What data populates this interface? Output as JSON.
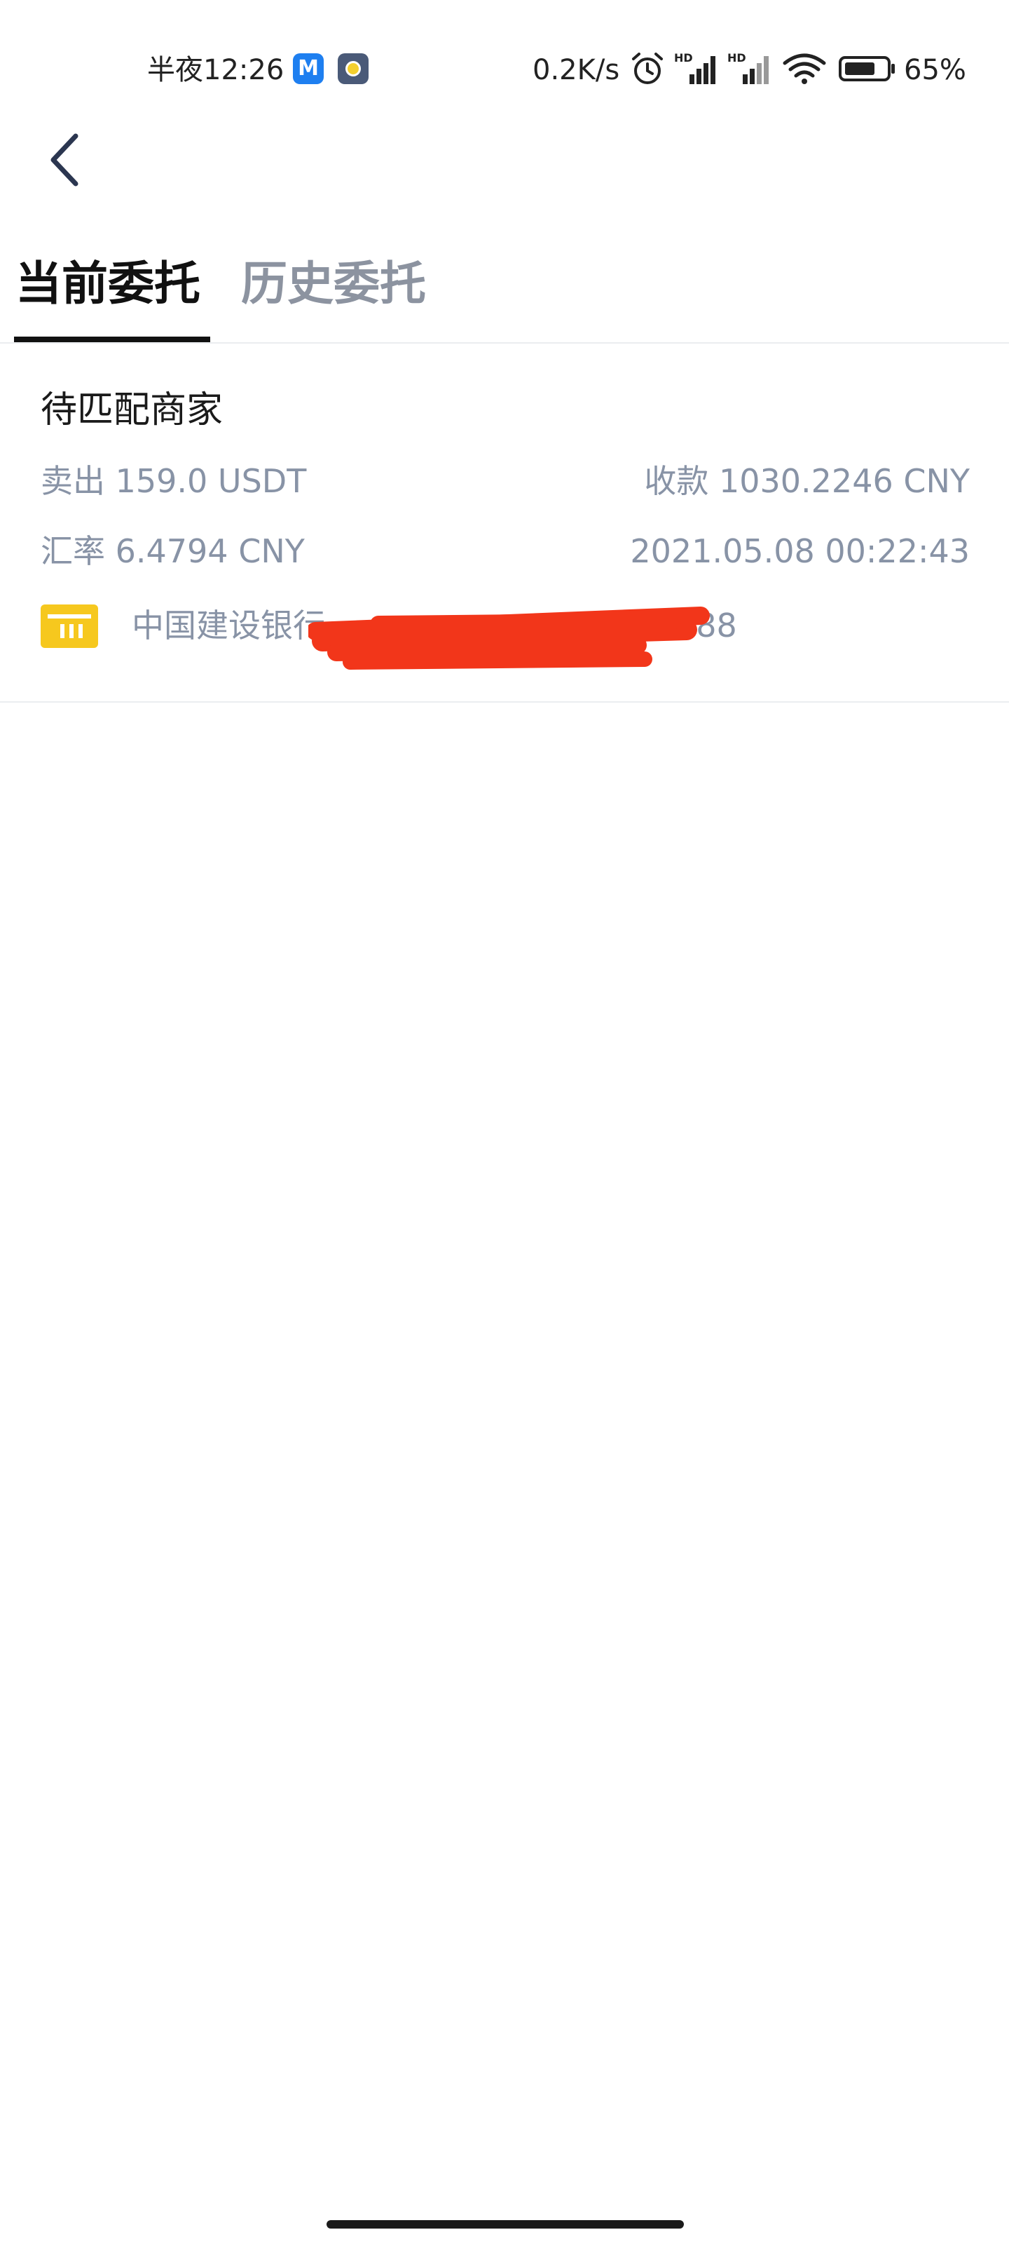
{
  "status_bar": {
    "time": "半夜12:26",
    "net_speed": "0.2K/s",
    "battery": "65%",
    "app_icons": [
      "m-app-icon",
      "eye-app-icon"
    ],
    "icons": [
      "alarm-icon",
      "hd-signal-icon",
      "hd-signal-icon",
      "wifi-icon",
      "battery-icon"
    ]
  },
  "header": {
    "back_icon": "chevron-left-icon"
  },
  "tabs": [
    {
      "label": "当前委托",
      "active": true
    },
    {
      "label": "历史委托",
      "active": false
    }
  ],
  "order": {
    "status": "待匹配商家",
    "sell": "卖出 159.0 USDT",
    "receive": "收款 1030.2246 CNY",
    "rate": "汇率 6.4794 CNY",
    "time": "2021.05.08 00:22:43",
    "bank": "中国建设银行",
    "bank_suffix": "388",
    "bank_icon": "bank-card-icon"
  },
  "colors": {
    "text_primary": "#111111",
    "text_secondary": "#8893a6",
    "tab_inactive": "#8c93a0",
    "bank_icon": "#f6c81e",
    "redaction": "#f2361a"
  }
}
